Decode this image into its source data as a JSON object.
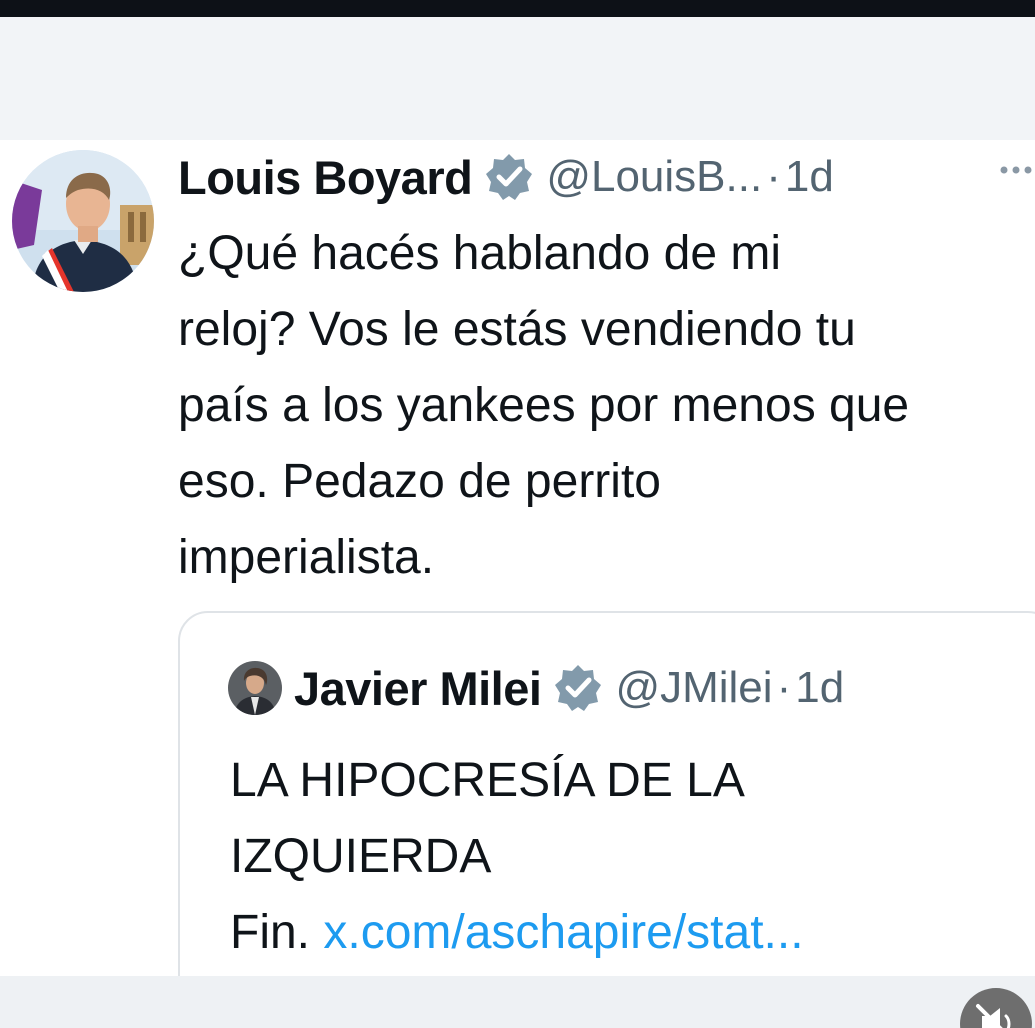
{
  "tweet": {
    "name": "Louis Boyard",
    "handle": "@LouisB...",
    "separator": "·",
    "time": "1d",
    "text": "¿Qué hacés hablando de mi\nreloj? Vos le estás vendiendo tu\npaís a los yankees por menos que\neso. Pedazo de perrito\nimperialista."
  },
  "quoted": {
    "name": "Javier Milei",
    "handle": "@JMilei",
    "separator": "·",
    "time": "1d",
    "text": "LA HIPOCRESÍA DE LA\nIZQUIERDA",
    "link_prefix": "Fin. ",
    "link_text": "x.com/aschapire/stat..."
  },
  "colors": {
    "verified_badge": "#829aab",
    "link": "#1d9bf0",
    "secondary_text": "#536471"
  },
  "icons": {
    "badge": "verified-badge-icon",
    "more": "more-options-icon",
    "mute": "muted-speaker-icon"
  }
}
